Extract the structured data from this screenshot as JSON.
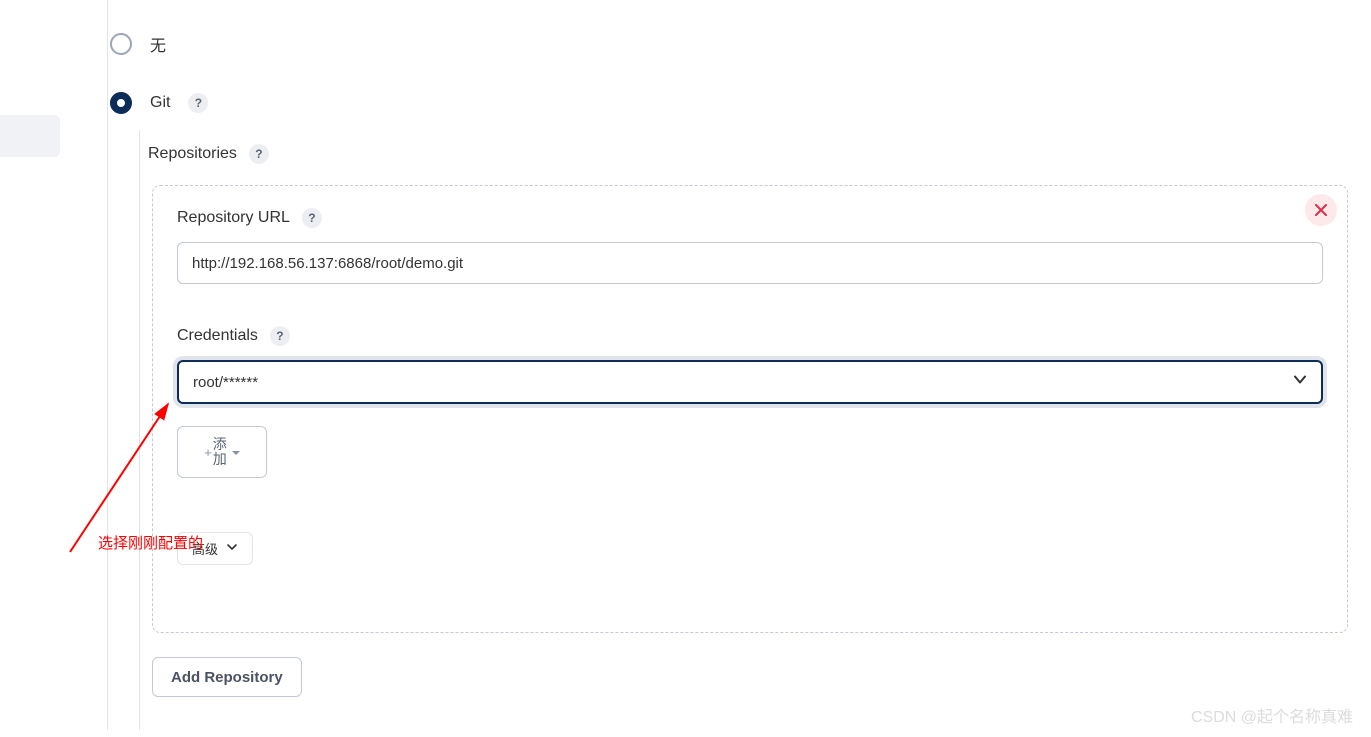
{
  "scm": {
    "none_label": "无",
    "git_label": "Git",
    "selected": "git"
  },
  "repositories": {
    "section_label": "Repositories",
    "url_label": "Repository URL",
    "url_value": "http://192.168.56.137:6868/root/demo.git",
    "credentials_label": "Credentials",
    "credentials_value": "root/******",
    "add_button_label": "添加",
    "advanced_label": "高级",
    "add_repository_label": "Add Repository"
  },
  "annotation": {
    "text": "选择刚刚配置的"
  },
  "watermark": "CSDN @起个名称真难",
  "help_glyph": "?"
}
